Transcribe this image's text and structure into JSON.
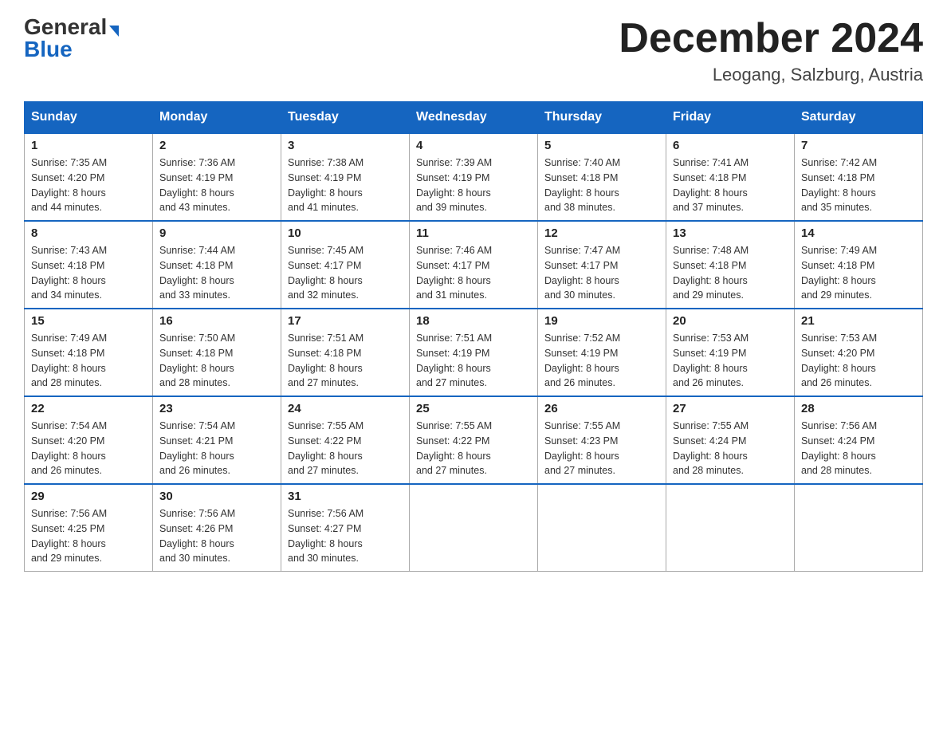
{
  "header": {
    "logo_general": "General",
    "logo_blue": "Blue",
    "month_title": "December 2024",
    "location": "Leogang, Salzburg, Austria"
  },
  "days_of_week": [
    "Sunday",
    "Monday",
    "Tuesday",
    "Wednesday",
    "Thursday",
    "Friday",
    "Saturday"
  ],
  "weeks": [
    [
      {
        "day": "1",
        "sunrise": "7:35 AM",
        "sunset": "4:20 PM",
        "daylight": "8 hours and 44 minutes."
      },
      {
        "day": "2",
        "sunrise": "7:36 AM",
        "sunset": "4:19 PM",
        "daylight": "8 hours and 43 minutes."
      },
      {
        "day": "3",
        "sunrise": "7:38 AM",
        "sunset": "4:19 PM",
        "daylight": "8 hours and 41 minutes."
      },
      {
        "day": "4",
        "sunrise": "7:39 AM",
        "sunset": "4:19 PM",
        "daylight": "8 hours and 39 minutes."
      },
      {
        "day": "5",
        "sunrise": "7:40 AM",
        "sunset": "4:18 PM",
        "daylight": "8 hours and 38 minutes."
      },
      {
        "day": "6",
        "sunrise": "7:41 AM",
        "sunset": "4:18 PM",
        "daylight": "8 hours and 37 minutes."
      },
      {
        "day": "7",
        "sunrise": "7:42 AM",
        "sunset": "4:18 PM",
        "daylight": "8 hours and 35 minutes."
      }
    ],
    [
      {
        "day": "8",
        "sunrise": "7:43 AM",
        "sunset": "4:18 PM",
        "daylight": "8 hours and 34 minutes."
      },
      {
        "day": "9",
        "sunrise": "7:44 AM",
        "sunset": "4:18 PM",
        "daylight": "8 hours and 33 minutes."
      },
      {
        "day": "10",
        "sunrise": "7:45 AM",
        "sunset": "4:17 PM",
        "daylight": "8 hours and 32 minutes."
      },
      {
        "day": "11",
        "sunrise": "7:46 AM",
        "sunset": "4:17 PM",
        "daylight": "8 hours and 31 minutes."
      },
      {
        "day": "12",
        "sunrise": "7:47 AM",
        "sunset": "4:17 PM",
        "daylight": "8 hours and 30 minutes."
      },
      {
        "day": "13",
        "sunrise": "7:48 AM",
        "sunset": "4:18 PM",
        "daylight": "8 hours and 29 minutes."
      },
      {
        "day": "14",
        "sunrise": "7:49 AM",
        "sunset": "4:18 PM",
        "daylight": "8 hours and 29 minutes."
      }
    ],
    [
      {
        "day": "15",
        "sunrise": "7:49 AM",
        "sunset": "4:18 PM",
        "daylight": "8 hours and 28 minutes."
      },
      {
        "day": "16",
        "sunrise": "7:50 AM",
        "sunset": "4:18 PM",
        "daylight": "8 hours and 28 minutes."
      },
      {
        "day": "17",
        "sunrise": "7:51 AM",
        "sunset": "4:18 PM",
        "daylight": "8 hours and 27 minutes."
      },
      {
        "day": "18",
        "sunrise": "7:51 AM",
        "sunset": "4:19 PM",
        "daylight": "8 hours and 27 minutes."
      },
      {
        "day": "19",
        "sunrise": "7:52 AM",
        "sunset": "4:19 PM",
        "daylight": "8 hours and 26 minutes."
      },
      {
        "day": "20",
        "sunrise": "7:53 AM",
        "sunset": "4:19 PM",
        "daylight": "8 hours and 26 minutes."
      },
      {
        "day": "21",
        "sunrise": "7:53 AM",
        "sunset": "4:20 PM",
        "daylight": "8 hours and 26 minutes."
      }
    ],
    [
      {
        "day": "22",
        "sunrise": "7:54 AM",
        "sunset": "4:20 PM",
        "daylight": "8 hours and 26 minutes."
      },
      {
        "day": "23",
        "sunrise": "7:54 AM",
        "sunset": "4:21 PM",
        "daylight": "8 hours and 26 minutes."
      },
      {
        "day": "24",
        "sunrise": "7:55 AM",
        "sunset": "4:22 PM",
        "daylight": "8 hours and 27 minutes."
      },
      {
        "day": "25",
        "sunrise": "7:55 AM",
        "sunset": "4:22 PM",
        "daylight": "8 hours and 27 minutes."
      },
      {
        "day": "26",
        "sunrise": "7:55 AM",
        "sunset": "4:23 PM",
        "daylight": "8 hours and 27 minutes."
      },
      {
        "day": "27",
        "sunrise": "7:55 AM",
        "sunset": "4:24 PM",
        "daylight": "8 hours and 28 minutes."
      },
      {
        "day": "28",
        "sunrise": "7:56 AM",
        "sunset": "4:24 PM",
        "daylight": "8 hours and 28 minutes."
      }
    ],
    [
      {
        "day": "29",
        "sunrise": "7:56 AM",
        "sunset": "4:25 PM",
        "daylight": "8 hours and 29 minutes."
      },
      {
        "day": "30",
        "sunrise": "7:56 AM",
        "sunset": "4:26 PM",
        "daylight": "8 hours and 30 minutes."
      },
      {
        "day": "31",
        "sunrise": "7:56 AM",
        "sunset": "4:27 PM",
        "daylight": "8 hours and 30 minutes."
      },
      null,
      null,
      null,
      null
    ]
  ],
  "labels": {
    "sunrise": "Sunrise:",
    "sunset": "Sunset:",
    "daylight": "Daylight:"
  }
}
